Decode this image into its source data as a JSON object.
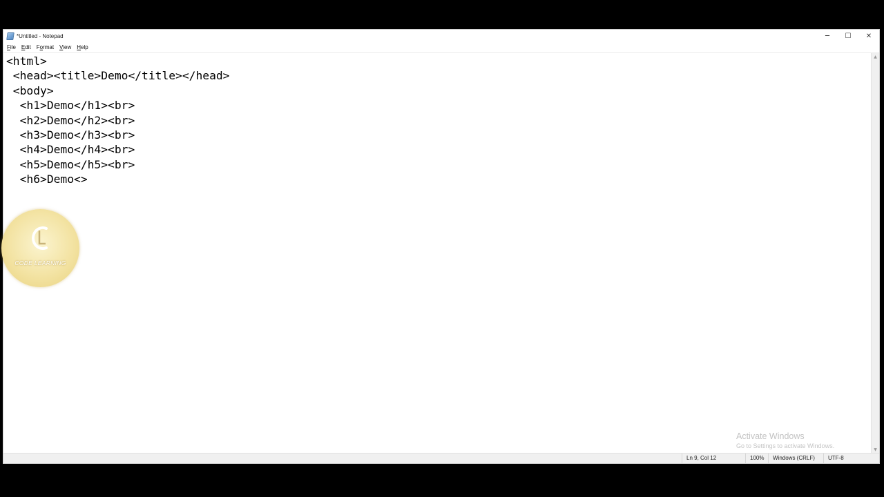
{
  "window": {
    "title": "*Untitled - Notepad",
    "controls": {
      "minimize": "─",
      "maximize": "☐",
      "close": "✕"
    }
  },
  "menu": {
    "items": [
      {
        "accel": "F",
        "rest": "ile"
      },
      {
        "accel": "E",
        "rest": "dit"
      },
      {
        "pre": "F",
        "accel": "o",
        "rest": "rmat"
      },
      {
        "accel": "V",
        "rest": "iew"
      },
      {
        "accel": "H",
        "rest": "elp"
      }
    ]
  },
  "editor": {
    "lines": [
      "<html>",
      " <head><title>Demo</title></head>",
      " <body>",
      "  <h1>Demo</h1><br>",
      "  <h2>Demo</h2><br>",
      "  <h3>Demo</h3><br>",
      "  <h4>Demo</h4><br>",
      "  <h5>Demo</h5><br>",
      "  <h6>Demo<>"
    ]
  },
  "status": {
    "position": "Ln 9, Col 12",
    "zoom": "100%",
    "line_ending": "Windows (CRLF)",
    "encoding": "UTF-8"
  },
  "overlay": {
    "logo_text": "CODE LEARNING",
    "activate_title": "Activate Windows",
    "activate_sub": "Go to Settings to activate Windows."
  },
  "colors": {
    "logo_gold": "#f3e3a3",
    "desktop_background": "#000000",
    "editor_background": "#ffffff"
  }
}
